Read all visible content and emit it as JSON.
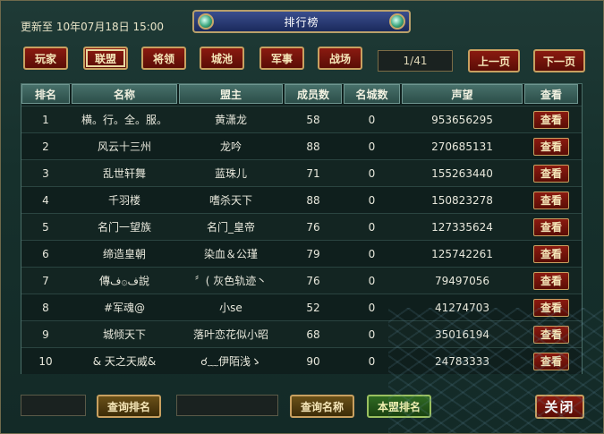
{
  "header": {
    "update_text": "更新至 10年07月18日 15:00",
    "title": "排行榜"
  },
  "tabs": [
    {
      "label": "玩家",
      "active": false
    },
    {
      "label": "联盟",
      "active": true
    },
    {
      "label": "将领",
      "active": false
    },
    {
      "label": "城池",
      "active": false
    },
    {
      "label": "军事",
      "active": false
    },
    {
      "label": "战场",
      "active": false
    }
  ],
  "pagination": {
    "page_text": "1/41",
    "prev_label": "上一页",
    "next_label": "下一页"
  },
  "table": {
    "columns": [
      "排名",
      "名称",
      "盟主",
      "成员数",
      "名城数",
      "声望",
      "查看"
    ],
    "view_label": "查看",
    "rows": [
      {
        "rank": "1",
        "name": "横。行。全。服。",
        "leader": "黄潇龙",
        "members": "58",
        "cities": "0",
        "fame": "953656295"
      },
      {
        "rank": "2",
        "name": "风云十三州",
        "leader": "龙吟",
        "members": "88",
        "cities": "0",
        "fame": "270685131"
      },
      {
        "rank": "3",
        "name": "乱世轩舞",
        "leader": "蓝珠儿",
        "members": "71",
        "cities": "0",
        "fame": "155263440"
      },
      {
        "rank": "4",
        "name": "千羽楼",
        "leader": "嗜杀天下",
        "members": "88",
        "cities": "0",
        "fame": "150823278"
      },
      {
        "rank": "5",
        "name": "名门一望族",
        "leader": "名门_皇帝",
        "members": "76",
        "cities": "0",
        "fame": "127335624"
      },
      {
        "rank": "6",
        "name": "缔造皇朝",
        "leader": "染血＆公瑾",
        "members": "79",
        "cities": "0",
        "fame": "125742261"
      },
      {
        "rank": "7",
        "name": "傳ف۞ف說",
        "leader": "〞( 灰色轨迹丶",
        "members": "76",
        "cities": "0",
        "fame": "79497056"
      },
      {
        "rank": "8",
        "name": "#军魂@",
        "leader": "小se",
        "members": "52",
        "cities": "0",
        "fame": "41274703"
      },
      {
        "rank": "9",
        "name": "城倾天下",
        "leader": "落叶恋花似小昭",
        "members": "68",
        "cities": "0",
        "fame": "35016194"
      },
      {
        "rank": "10",
        "name": "& 天之天威&",
        "leader": "☌﹏伊陌浅ゝ",
        "members": "90",
        "cities": "0",
        "fame": "24783333"
      }
    ]
  },
  "footer": {
    "search_rank_label": "查询排名",
    "search_name_label": "查询名称",
    "alliance_rank_label": "本盟排名",
    "close_label": "关闭"
  }
}
